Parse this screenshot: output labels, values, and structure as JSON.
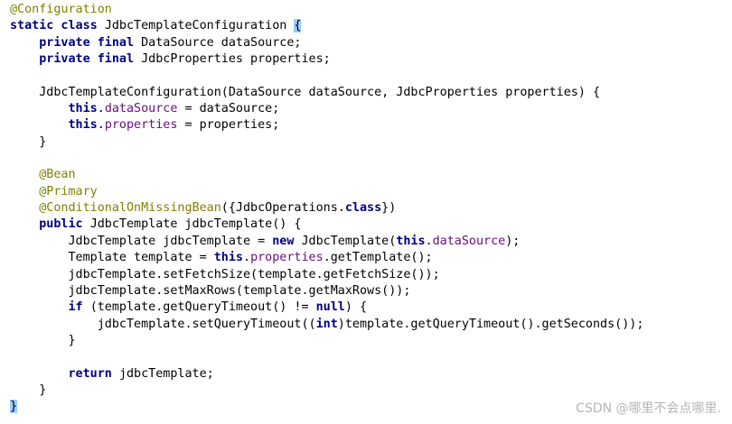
{
  "editor": {
    "lines": [
      [
        {
          "t": "@Configuration",
          "k": "ann"
        }
      ],
      [
        {
          "t": "static class ",
          "k": "kw"
        },
        {
          "t": "JdbcTemplateConfiguration ",
          "k": "plain"
        },
        {
          "t": "{",
          "k": "brace"
        }
      ],
      [
        {
          "t": "    "
        },
        {
          "t": "private final ",
          "k": "kw"
        },
        {
          "t": "DataSource dataSource;",
          "k": "plain"
        }
      ],
      [
        {
          "t": "    "
        },
        {
          "t": "private final ",
          "k": "kw"
        },
        {
          "t": "JdbcProperties properties;",
          "k": "plain"
        }
      ],
      [],
      [
        {
          "t": "    "
        },
        {
          "t": "JdbcTemplateConfiguration(DataSource dataSource, JdbcProperties properties) {",
          "k": "plain"
        }
      ],
      [
        {
          "t": "        "
        },
        {
          "t": "this",
          "k": "kw"
        },
        {
          "t": ".",
          "k": "plain"
        },
        {
          "t": "dataSource",
          "k": "field"
        },
        {
          "t": " = dataSource;",
          "k": "plain"
        }
      ],
      [
        {
          "t": "        "
        },
        {
          "t": "this",
          "k": "kw"
        },
        {
          "t": ".",
          "k": "plain"
        },
        {
          "t": "properties",
          "k": "field"
        },
        {
          "t": " = properties;",
          "k": "plain"
        }
      ],
      [
        {
          "t": "    "
        },
        {
          "t": "}",
          "k": "plain"
        }
      ],
      [],
      [
        {
          "t": "    "
        },
        {
          "t": "@Bean",
          "k": "ann"
        }
      ],
      [
        {
          "t": "    "
        },
        {
          "t": "@Primary",
          "k": "ann"
        }
      ],
      [
        {
          "t": "    "
        },
        {
          "t": "@ConditionalOnMissingBean",
          "k": "ann"
        },
        {
          "t": "({JdbcOperations.",
          "k": "plain"
        },
        {
          "t": "class",
          "k": "kw"
        },
        {
          "t": "})",
          "k": "plain"
        }
      ],
      [
        {
          "t": "    "
        },
        {
          "t": "public ",
          "k": "kw"
        },
        {
          "t": "JdbcTemplate jdbcTemplate() {",
          "k": "plain"
        }
      ],
      [
        {
          "t": "        "
        },
        {
          "t": "JdbcTemplate jdbcTemplate = ",
          "k": "plain"
        },
        {
          "t": "new ",
          "k": "kw"
        },
        {
          "t": "JdbcTemplate(",
          "k": "plain"
        },
        {
          "t": "this",
          "k": "kw"
        },
        {
          "t": ".",
          "k": "plain"
        },
        {
          "t": "dataSource",
          "k": "field"
        },
        {
          "t": ");",
          "k": "plain"
        }
      ],
      [
        {
          "t": "        "
        },
        {
          "t": "Template template = ",
          "k": "plain"
        },
        {
          "t": "this",
          "k": "kw"
        },
        {
          "t": ".",
          "k": "plain"
        },
        {
          "t": "properties",
          "k": "field"
        },
        {
          "t": ".getTemplate();",
          "k": "plain"
        }
      ],
      [
        {
          "t": "        "
        },
        {
          "t": "jdbcTemplate.setFetchSize(template.getFetchSize());",
          "k": "plain"
        }
      ],
      [
        {
          "t": "        "
        },
        {
          "t": "jdbcTemplate.setMaxRows(template.getMaxRows());",
          "k": "plain"
        }
      ],
      [
        {
          "t": "        "
        },
        {
          "t": "if ",
          "k": "kw"
        },
        {
          "t": "(template.getQueryTimeout() != ",
          "k": "plain"
        },
        {
          "t": "null",
          "k": "kw"
        },
        {
          "t": ") {",
          "k": "plain"
        }
      ],
      [
        {
          "t": "            "
        },
        {
          "t": "jdbcTemplate.setQueryTimeout((",
          "k": "plain"
        },
        {
          "t": "int",
          "k": "kw"
        },
        {
          "t": ")template.getQueryTimeout().getSeconds());",
          "k": "plain"
        }
      ],
      [
        {
          "t": "        "
        },
        {
          "t": "}",
          "k": "plain"
        }
      ],
      [],
      [
        {
          "t": "        "
        },
        {
          "t": "return ",
          "k": "kw"
        },
        {
          "t": "jdbcTemplate;",
          "k": "plain"
        }
      ],
      [
        {
          "t": "    "
        },
        {
          "t": "}",
          "k": "plain"
        }
      ],
      [
        {
          "t": "}",
          "k": "brace"
        }
      ]
    ]
  },
  "watermark": {
    "text": "CSDN @哪里不会点哪里."
  },
  "colors": {
    "keyword": "#000080",
    "annotation": "#808000",
    "field": "#660e7a",
    "plain": "#000000",
    "brace_match_bg": "#99ccff",
    "watermark": "#b5b5b5"
  }
}
